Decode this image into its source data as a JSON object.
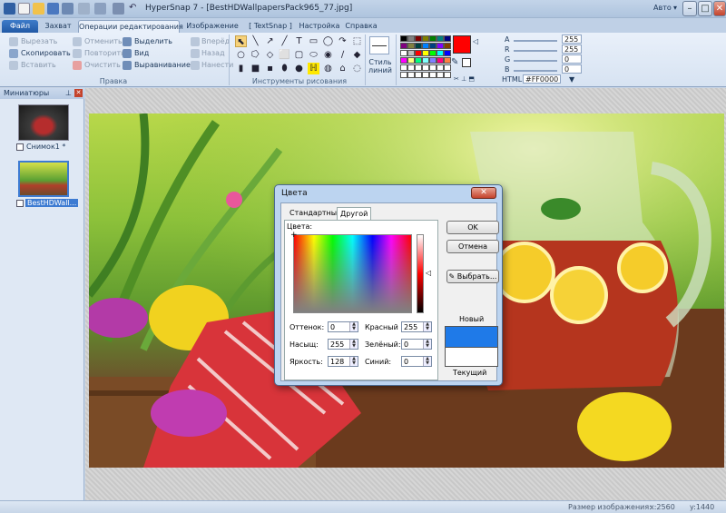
{
  "window": {
    "title": "HyperSnap 7 - [BestHDWallpapersPack965_77.jpg]",
    "controls": {
      "minimize": "–",
      "maximize": "□",
      "close": "✕"
    },
    "mode_label": "Авто"
  },
  "tabs": [
    {
      "label": "Файл"
    },
    {
      "label": "Захват"
    },
    {
      "label": "Операции редактирования"
    },
    {
      "label": "Изображение"
    },
    {
      "label": "[ TextSnap ]"
    },
    {
      "label": "Настройка"
    },
    {
      "label": "Справка"
    }
  ],
  "ribbon": {
    "edit": {
      "cut": "Вырезать",
      "copy": "Скопировать",
      "paste": "Вставить",
      "undo": "Отменить",
      "redo": "Повторить",
      "clear": "Очистить",
      "select": "Выделить",
      "view": "Вид",
      "align": "Выравнивание",
      "forward": "Вперёд",
      "back": "Назад",
      "apply": "Нанести",
      "group_label": "Правка"
    },
    "drawing": {
      "group_label": "Инструменты рисования",
      "highlighter": "H"
    },
    "line_style": {
      "label": "Стиль линий"
    },
    "color": {
      "a_label": "A",
      "a_value": "255",
      "r_label": "R",
      "r_value": "255",
      "g_label": "G",
      "g_value": "0",
      "b_label": "B",
      "b_value": "0",
      "html_label": "HTML:",
      "html_value": "#FF0000",
      "current_color": "#ff0000",
      "palette": [
        "#000000",
        "#808080",
        "#800000",
        "#808000",
        "#008000",
        "#008080",
        "#000080",
        "#800080",
        "#808040",
        "#004040",
        "#0080ff",
        "#004080",
        "#8000ff",
        "#804000",
        "#ffffff",
        "#c0c0c0",
        "#ff0000",
        "#ffff00",
        "#00ff00",
        "#00ffff",
        "#0000ff",
        "#ff00ff",
        "#ffff80",
        "#00ff80",
        "#80ffff",
        "#8080ff",
        "#ff0080",
        "#ff8040",
        "#ffffff",
        "#ffffff",
        "#ffffff",
        "#ffffff",
        "#ffffff",
        "#ffffff",
        "#ffffff",
        "#ffffff",
        "#ffffff",
        "#ffffff",
        "#ffffff",
        "#ffffff",
        "#ffffff",
        "#ffffff"
      ]
    }
  },
  "sidebar": {
    "title": "Миниатюры",
    "items": [
      {
        "label": "Снимок1 *"
      },
      {
        "label": "BestHDWall..."
      }
    ]
  },
  "dialog": {
    "title": "Цвета",
    "close": "✕",
    "tab_standard": "Стандартный",
    "tab_custom": "Другой",
    "colors_label": "Цвета:",
    "hue_label": "Оттенок:",
    "hue_value": "0",
    "sat_label": "Насыщ:",
    "sat_value": "255",
    "lum_label": "Яркость:",
    "lum_value": "128",
    "red_label": "Красный",
    "red_value": "255",
    "green_label": "Зелёный:",
    "green_value": "0",
    "blue_label": "Синий:",
    "blue_value": "0",
    "ok": "OK",
    "cancel": "Отмена",
    "pick": "Выбрать...",
    "new_label": "Новый",
    "current_label": "Текущий",
    "new_color": "#1f7ae8",
    "current_color": "#ffffff"
  },
  "status": {
    "size_label": "Размер изображения:",
    "width": "x:2560",
    "height": "y:1440"
  }
}
